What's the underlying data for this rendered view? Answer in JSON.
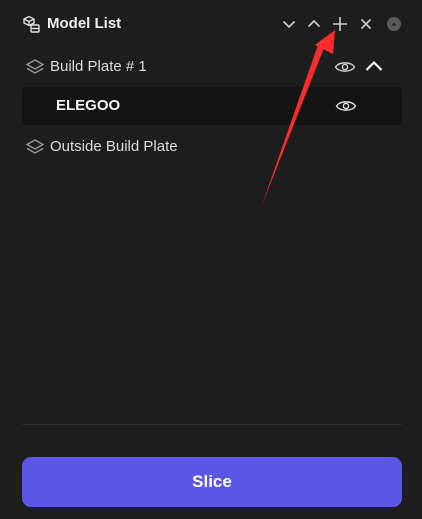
{
  "header": {
    "title": "Model List",
    "icons": [
      "cube-plate-icon",
      "chevron-down-icon",
      "chevron-up-icon",
      "plus-icon",
      "close-icon",
      "collapse-icon"
    ]
  },
  "tree": {
    "plate": {
      "label": "Build Plate # 1",
      "icon": "layers-icon"
    },
    "model": {
      "label": "ELEGOO",
      "icon": "eye-icon"
    },
    "outside": {
      "label": "Outside Build Plate",
      "icon": "layers-icon"
    }
  },
  "footer": {
    "slice_label": "Slice"
  },
  "colors": {
    "background": "#1e1e1e",
    "accent": "#5b55e8",
    "selected_row": "#141414",
    "annotation_arrow": "#ff2d2d"
  }
}
